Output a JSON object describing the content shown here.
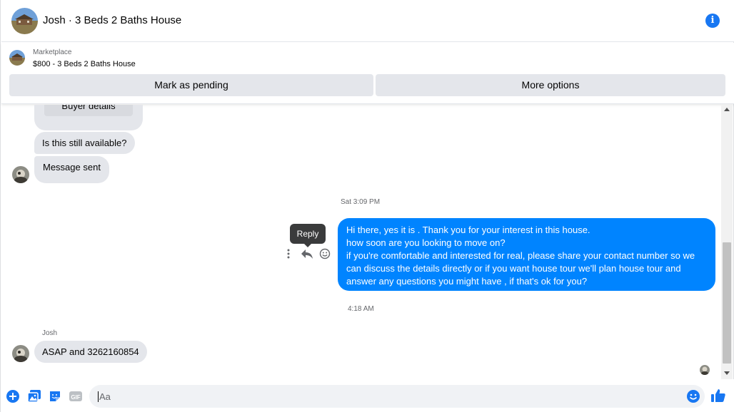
{
  "header": {
    "title": "Josh · 3 Beds 2 Baths House"
  },
  "marketplace": {
    "label": "Marketplace",
    "item": "$800 - 3 Beds 2 Baths House",
    "mark_pending_label": "Mark as pending",
    "more_options_label": "More options"
  },
  "messages": {
    "buyer_details_label": "Buyer details",
    "still_available": "Is this still available?",
    "message_sent": "Message sent",
    "timestamp_1": "Sat 3:09 PM",
    "reply_tooltip": "Reply",
    "outgoing_lines": [
      "Hi there, yes it is . Thank you for your interest in this house.",
      "how soon are you looking to move on?",
      "if you're comfortable and interested for real, please share your contact number so we",
      "can discuss the details directly or if you  want house tour we'll plan house tour and",
      "answer any questions you might have , if that's ok for you?"
    ],
    "timestamp_2": "4:18 AM",
    "sender_name": "Josh",
    "asap_reply": "ASAP and 3262160854"
  },
  "composer": {
    "placeholder": "Aa",
    "gif_label": "GIF"
  },
  "colors": {
    "accent": "#0084ff",
    "brand": "#1877f2",
    "bubble_gray": "#e4e6eb"
  }
}
